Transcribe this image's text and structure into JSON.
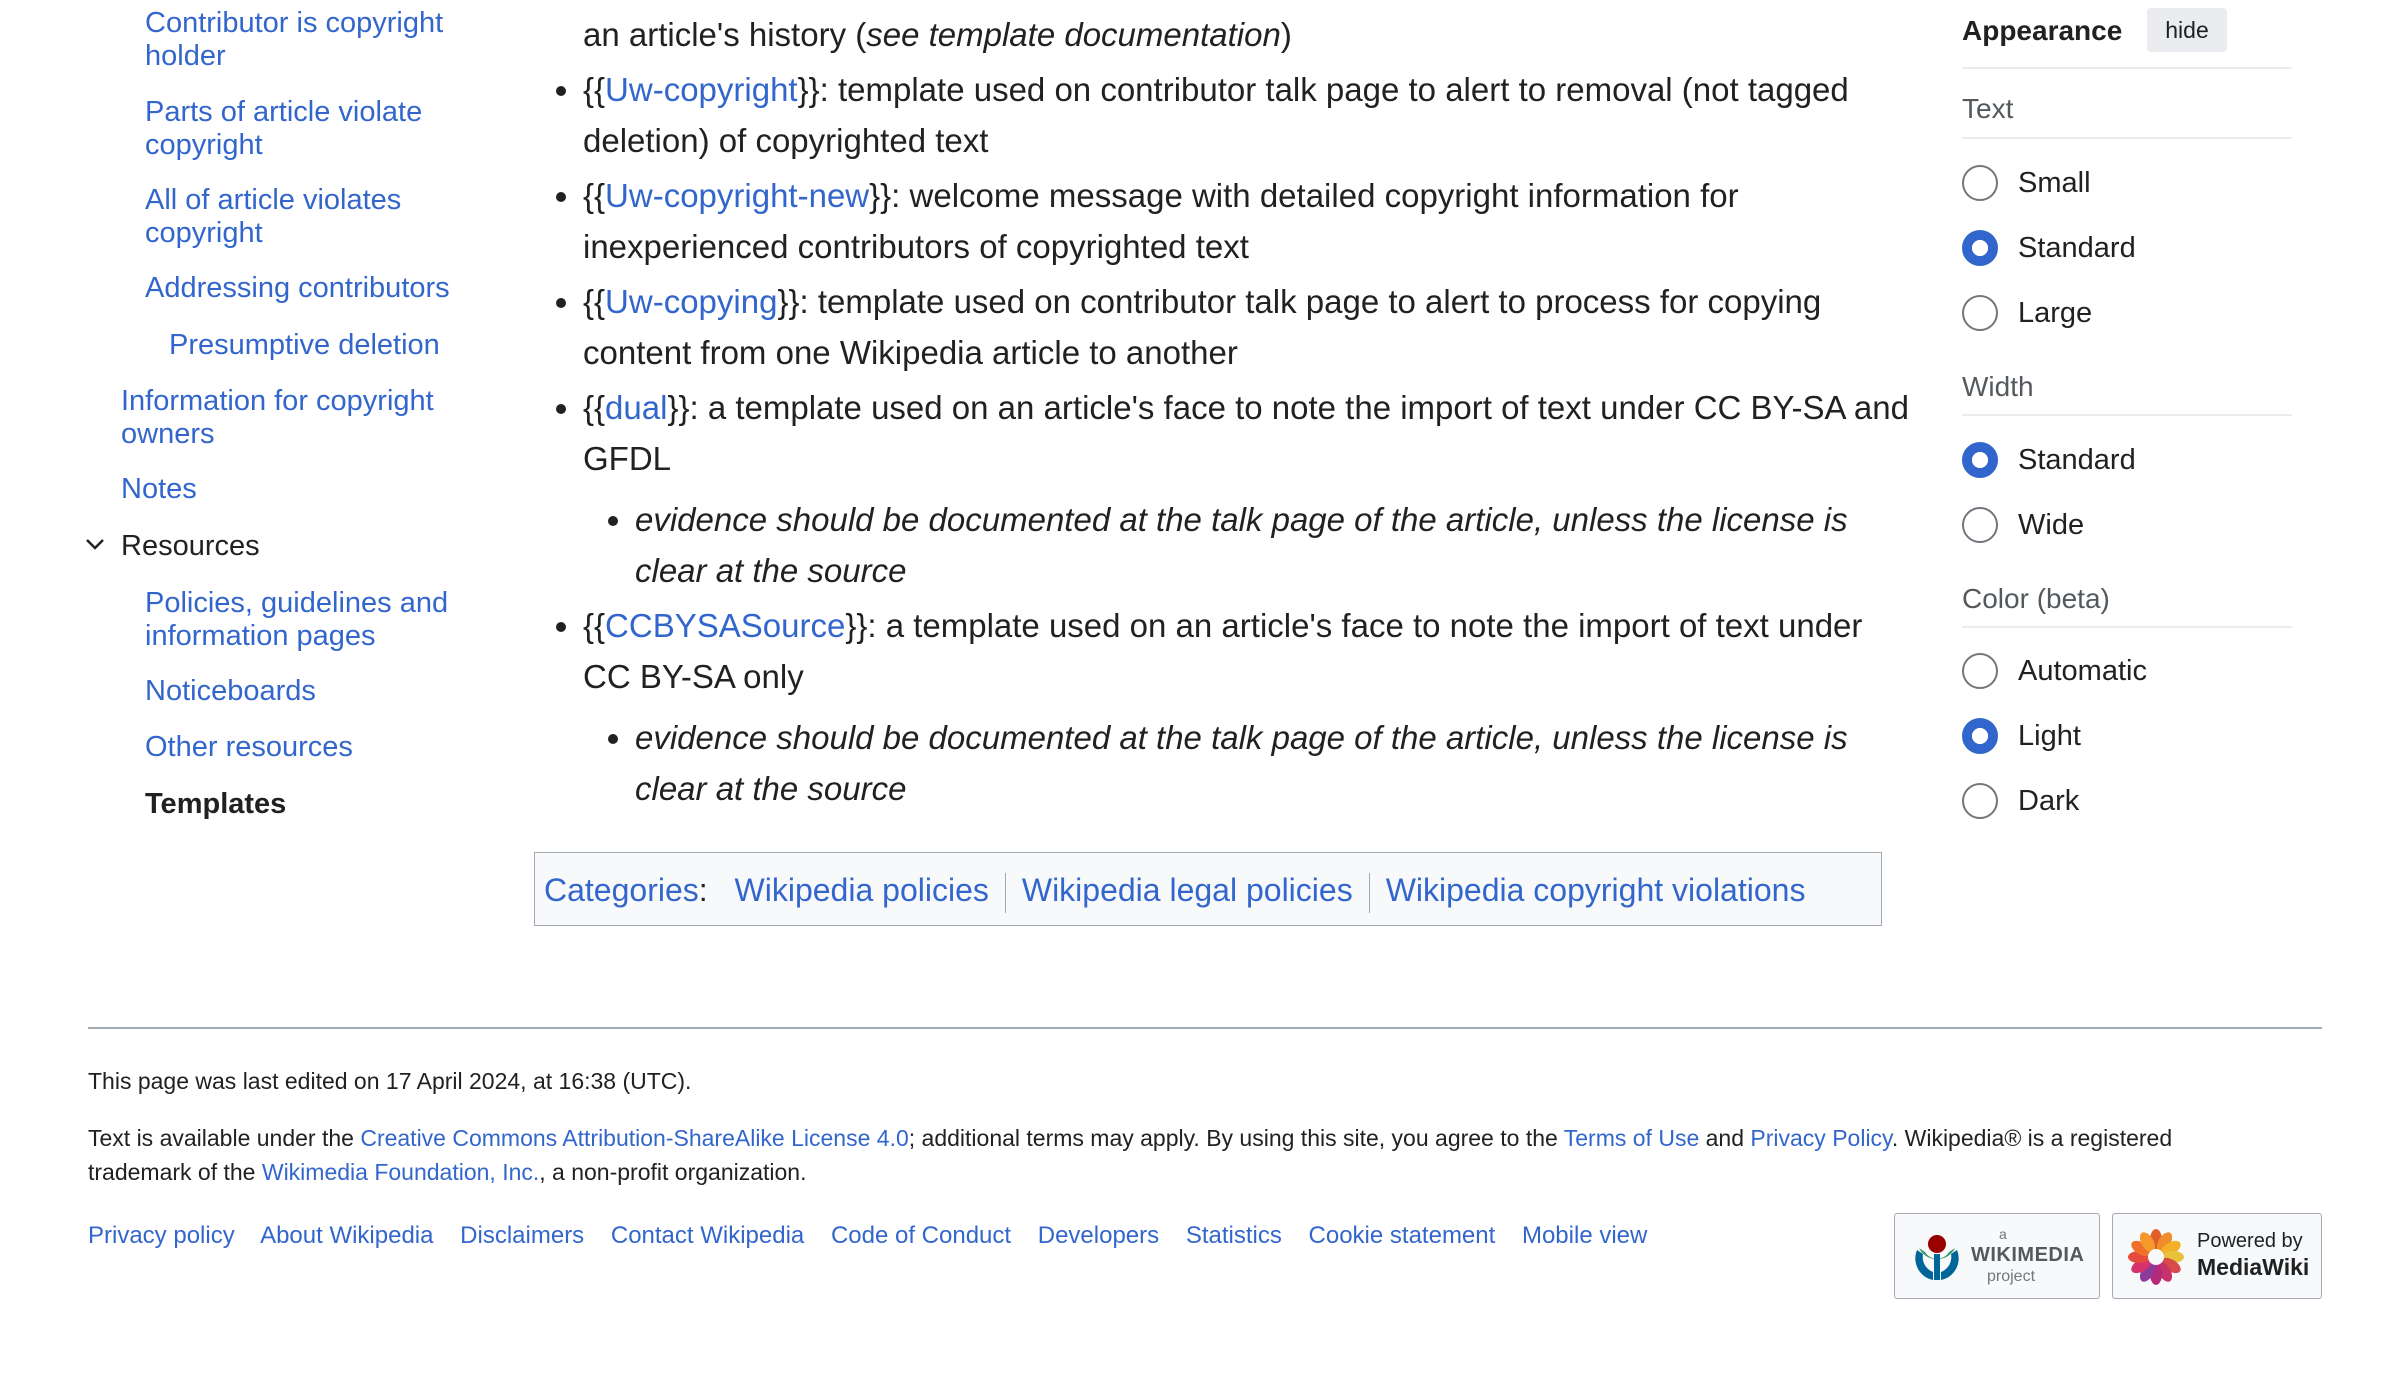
{
  "toc": {
    "items": [
      {
        "label": "Contributor is copyright holder",
        "level": "l2"
      },
      {
        "label": "Parts of article violate copyright",
        "level": "l2"
      },
      {
        "label": "All of article violates copyright",
        "level": "l2"
      },
      {
        "label": "Addressing contributors",
        "level": "l2"
      },
      {
        "label": "Presumptive deletion",
        "level": "l3"
      },
      {
        "label": "Information for copyright owners",
        "level": "l1"
      },
      {
        "label": "Notes",
        "level": "l1"
      },
      {
        "label": "Resources",
        "level": "heading"
      },
      {
        "label": "Policies, guidelines and information pages",
        "level": "l2"
      },
      {
        "label": "Noticeboards",
        "level": "l2"
      },
      {
        "label": "Other resources",
        "level": "l2"
      },
      {
        "label": "Templates",
        "level": "current"
      }
    ]
  },
  "content": {
    "line0_pre": "an article's history (",
    "line0_em": "see template documentation",
    "line0_post": ")",
    "items": [
      {
        "link": "Uw-copyright",
        "rest": "}}: template used on contributor talk page to alert to removal (not tagged",
        "cont": "deletion) of copyrighted text"
      },
      {
        "link": "Uw-copyright-new",
        "rest": "}}: welcome message with detailed copyright information for",
        "cont": "inexperienced contributors of copyrighted text"
      },
      {
        "link": "Uw-copying",
        "rest": "}}: template used on contributor talk page to alert to process for copying",
        "cont": "content from one Wikipedia article to another"
      },
      {
        "link": "dual",
        "rest": "}}: a template used on an article's face to note the import of text under CC BY-SA and",
        "cont": "GFDL"
      },
      {
        "link": "CCBYSASource",
        "rest": "}}: a template used on an article's face to note the import of text under",
        "cont": "CC BY-SA only"
      }
    ],
    "open_braces": "{{",
    "sub_note_1": "evidence should be documented at the talk page of the article, unless the license is",
    "sub_note_2": "clear at the source"
  },
  "categories": {
    "label": "Categories",
    "colon": ":",
    "links": [
      "Wikipedia policies",
      "Wikipedia legal policies",
      "Wikipedia copyright violations"
    ]
  },
  "appearance": {
    "title": "Appearance",
    "hide": "hide",
    "text_label": "Text",
    "text_options": [
      "Small",
      "Standard",
      "Large"
    ],
    "text_selected": "Standard",
    "width_label": "Width",
    "width_options": [
      "Standard",
      "Wide"
    ],
    "width_selected": "Standard",
    "color_label": "Color (beta)",
    "color_options": [
      "Automatic",
      "Light",
      "Dark"
    ],
    "color_selected": "Light"
  },
  "footer": {
    "last_edited": "This page was last edited on 17 April 2024, at 16:38 (UTC).",
    "license_1": "Text is available under the ",
    "license_link": "Creative Commons Attribution-ShareAlike License 4.0",
    "license_2": "; additional terms may apply. By using this site, you agree to the ",
    "terms_link": "Terms of Use",
    "license_3": " and ",
    "privacy_link": "Privacy Policy",
    "license_4": ". Wikipedia® is a registered",
    "license_5": "trademark of the ",
    "wmf_link": "Wikimedia Foundation, Inc.",
    "license_6": ", a non-profit organization.",
    "links": [
      "Privacy policy",
      "About Wikipedia",
      "Disclaimers",
      "Contact Wikipedia",
      "Code of Conduct",
      "Developers",
      "Statistics",
      "Cookie statement",
      "Mobile view"
    ],
    "wikimedia_badge": {
      "small": "a",
      "big": "WIKIMEDIA",
      "sub": "project"
    },
    "mediawiki_badge": {
      "line1": "Powered by",
      "line2": "MediaWiki"
    }
  },
  "colors": {
    "link": "#3366cc",
    "text": "#202122",
    "border": "#a2a9b1"
  }
}
